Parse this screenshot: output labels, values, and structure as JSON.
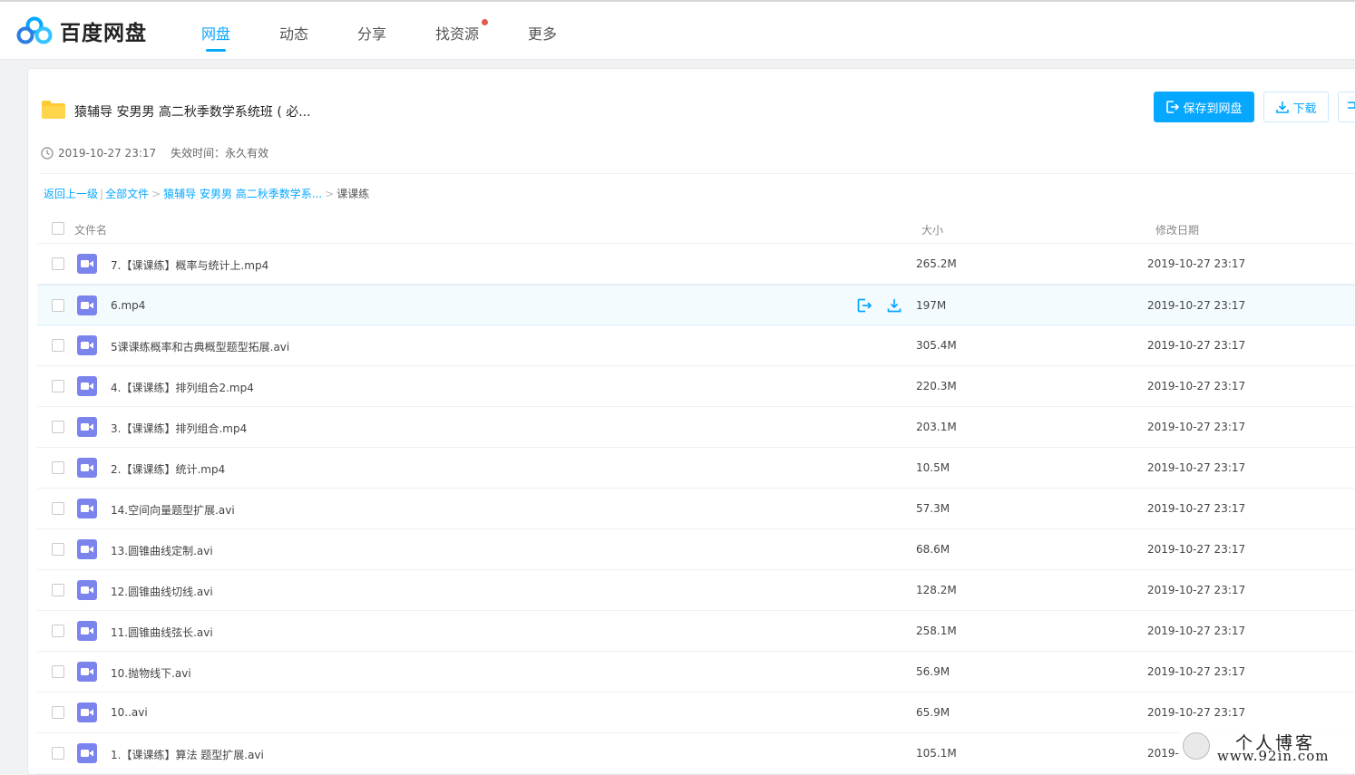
{
  "app": {
    "name": "百度网盘",
    "brand_color": "#06a7ff"
  },
  "nav": {
    "items": [
      {
        "label": "网盘",
        "active": true
      },
      {
        "label": "动态",
        "active": false
      },
      {
        "label": "分享",
        "active": false
      },
      {
        "label": "找资源",
        "active": false,
        "badge_dot": true
      },
      {
        "label": "更多",
        "active": false
      }
    ]
  },
  "share": {
    "title": "猿辅导 安男男 高二秋季数学系统班 ( 必...",
    "created": "2019-10-27 23:17",
    "expire_label": "失效时间：",
    "expire_value": "永久有效",
    "save_button": "保存到网盘",
    "download_button": "下载"
  },
  "breadcrumb": {
    "back": "返回上一级",
    "all": "全部文件",
    "folder": "猿辅导 安男男 高二秋季数学系...",
    "current": "课课练"
  },
  "table": {
    "headers": {
      "name": "文件名",
      "size": "大小",
      "date": "修改日期"
    },
    "rows": [
      {
        "name": "7.【课课练】概率与统计上.mp4",
        "size": "265.2M",
        "date": "2019-10-27 23:17",
        "icon": "video-file-icon"
      },
      {
        "name": "6.mp4",
        "size": "197M",
        "date": "2019-10-27 23:17",
        "icon": "video-file-icon",
        "hover": true
      },
      {
        "name": "5课课练概率和古典概型题型拓展.avi",
        "size": "305.4M",
        "date": "2019-10-27 23:17",
        "icon": "video-file-icon"
      },
      {
        "name": "4.【课课练】排列组合2.mp4",
        "size": "220.3M",
        "date": "2019-10-27 23:17",
        "icon": "video-file-icon"
      },
      {
        "name": "3.【课课练】排列组合.mp4",
        "size": "203.1M",
        "date": "2019-10-27 23:17",
        "icon": "video-file-icon"
      },
      {
        "name": "2.【课课练】统计.mp4",
        "size": "10.5M",
        "date": "2019-10-27 23:17",
        "icon": "video-file-icon"
      },
      {
        "name": "14.空间向量题型扩展.avi",
        "size": "57.3M",
        "date": "2019-10-27 23:17",
        "icon": "video-file-icon"
      },
      {
        "name": "13.圆锥曲线定制.avi",
        "size": "68.6M",
        "date": "2019-10-27 23:17",
        "icon": "video-file-icon"
      },
      {
        "name": "12.圆锥曲线切线.avi",
        "size": "128.2M",
        "date": "2019-10-27 23:17",
        "icon": "video-file-icon"
      },
      {
        "name": "11.圆锥曲线弦长.avi",
        "size": "258.1M",
        "date": "2019-10-27 23:17",
        "icon": "video-file-icon"
      },
      {
        "name": "10.抛物线下.avi",
        "size": "56.9M",
        "date": "2019-10-27 23:17",
        "icon": "video-file-icon"
      },
      {
        "name": "10..avi",
        "size": "65.9M",
        "date": "2019-10-27 23:17",
        "icon": "video-file-icon"
      },
      {
        "name": "1.【课课练】算法 题型扩展.avi",
        "size": "105.1M",
        "date": "2019-",
        "icon": "video-file-icon"
      }
    ]
  },
  "watermark": {
    "line1": "个人博客",
    "line2": "www.92in.com"
  }
}
